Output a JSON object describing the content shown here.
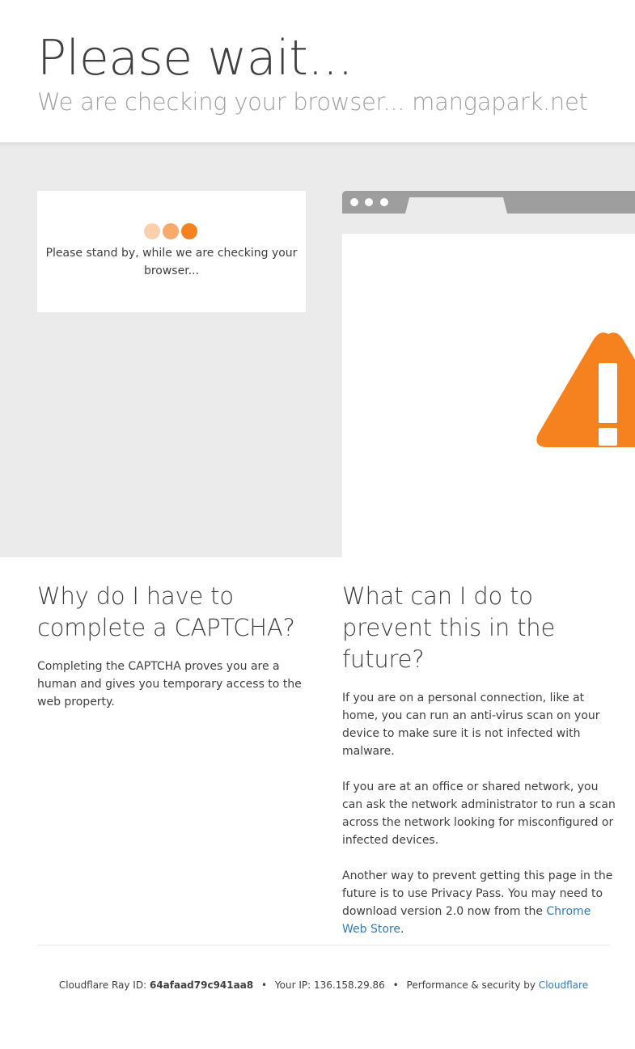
{
  "header": {
    "title": "Please wait...",
    "subtitle": "We are checking your browser... mangapark.net"
  },
  "standby": {
    "message": "Please stand by, while we are checking your browser..."
  },
  "browser_illustration": {
    "warning_icon": "warning-triangle-icon",
    "accent_color": "#f6821f"
  },
  "why": {
    "heading": "Why do I have to complete a CAPTCHA?",
    "body": "Completing the CAPTCHA proves you are a human and gives you temporary access to the web property."
  },
  "prevent": {
    "heading": "What can I do to prevent this in the future?",
    "p1": "If you are on a personal connection, like at home, you can run an anti-virus scan on your device to make sure it is not infected with malware.",
    "p2": "If you are at an office or shared network, you can ask the network administrator to run a scan across the network looking for misconfigured or infected devices.",
    "p3_prefix": "Another way to prevent getting this page in the future is to use Privacy Pass. You may need to download version 2.0 now from the ",
    "p3_link": "Chrome Web Store",
    "p3_suffix": "."
  },
  "footer": {
    "ray_label": "Cloudflare Ray ID:",
    "ray_id": "64afaad79c941aa8",
    "separator": "•",
    "ip_label": "Your IP:",
    "ip": "136.158.29.86",
    "perf_label": "Performance & security by",
    "perf_link": "Cloudflare"
  },
  "colors": {
    "link": "#2f7bbf",
    "orange": "#f6821f"
  }
}
